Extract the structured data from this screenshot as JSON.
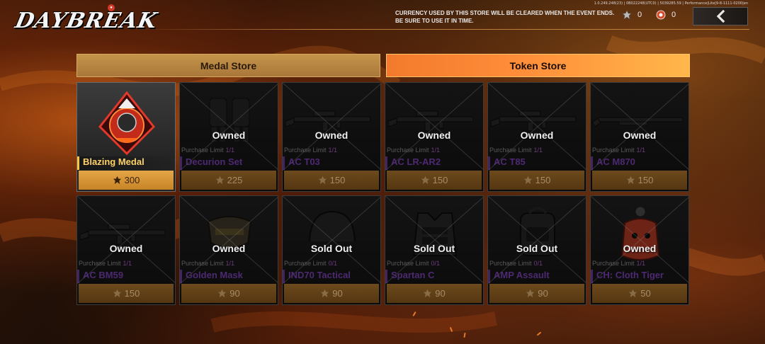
{
  "header": {
    "logo_text": "DAYBREAK",
    "notice": "CURRENCY USED BY THIS STORE WILL BE CLEARED WHEN THE EVENT ENDS. BE SURE TO USE IT IN TIME.",
    "version": "1.0.249.248(23) | 0B022248(UTC0) | 5039285.59 | Performance|Lite|9-8-1111-0200|en",
    "currency_medal_count": "0",
    "currency_token_count": "0"
  },
  "tabs": [
    {
      "label": "Medal Store",
      "active": false
    },
    {
      "label": "Token Store",
      "active": true
    }
  ],
  "items": [
    {
      "name": "Blazing Medal",
      "status": "",
      "limit_label": "",
      "limit_value": "",
      "price": "300",
      "featured": true,
      "icon": "blazing-medal"
    },
    {
      "name": "Decurion Set",
      "status": "Owned",
      "limit_label": "Purchase Limit",
      "limit_value": "1/1",
      "price": "225",
      "featured": false,
      "icon": "outfit"
    },
    {
      "name": "AC T03",
      "status": "Owned",
      "limit_label": "Purchase Limit",
      "limit_value": "1/1",
      "price": "150",
      "featured": false,
      "icon": "rifle"
    },
    {
      "name": "AC LR-AR2",
      "status": "Owned",
      "limit_label": "Purchase Limit",
      "limit_value": "1/1",
      "price": "150",
      "featured": false,
      "icon": "rifle"
    },
    {
      "name": "AC T85",
      "status": "Owned",
      "limit_label": "Purchase Limit",
      "limit_value": "1/1",
      "price": "150",
      "featured": false,
      "icon": "rifle"
    },
    {
      "name": "AC M870",
      "status": "Owned",
      "limit_label": "Purchase Limit",
      "limit_value": "1/1",
      "price": "150",
      "featured": false,
      "icon": "shotgun"
    },
    {
      "name": "AC BM59",
      "status": "Owned",
      "limit_label": "Purchase Limit",
      "limit_value": "1/1",
      "price": "150",
      "featured": false,
      "icon": "rifle"
    },
    {
      "name": "Golden Mask",
      "status": "Owned",
      "limit_label": "Purchase Limit",
      "limit_value": "1/1",
      "price": "90",
      "featured": false,
      "icon": "mask"
    },
    {
      "name": "IND70 Tactical",
      "status": "Sold Out",
      "limit_label": "Purchase Limit",
      "limit_value": "0/1",
      "price": "90",
      "featured": false,
      "icon": "helmet"
    },
    {
      "name": "Spartan C",
      "status": "Sold Out",
      "limit_label": "Purchase Limit",
      "limit_value": "0/1",
      "price": "90",
      "featured": false,
      "icon": "vest"
    },
    {
      "name": "AMP Assault",
      "status": "Sold Out",
      "limit_label": "Purchase Limit",
      "limit_value": "0/1",
      "price": "90",
      "featured": false,
      "icon": "backpack"
    },
    {
      "name": "CH: Cloth Tiger",
      "status": "Owned",
      "limit_label": "Purchase Limit",
      "limit_value": "1/1",
      "price": "50",
      "featured": false,
      "icon": "charm"
    }
  ],
  "colors": {
    "medal_tab": "#b88a44",
    "token_tab": "#ff8e3a",
    "featured_price": "#d8962f",
    "price_bar": "#5e3f17",
    "item_name_dim": "#783cb4",
    "featured_name": "#ffd26a"
  }
}
